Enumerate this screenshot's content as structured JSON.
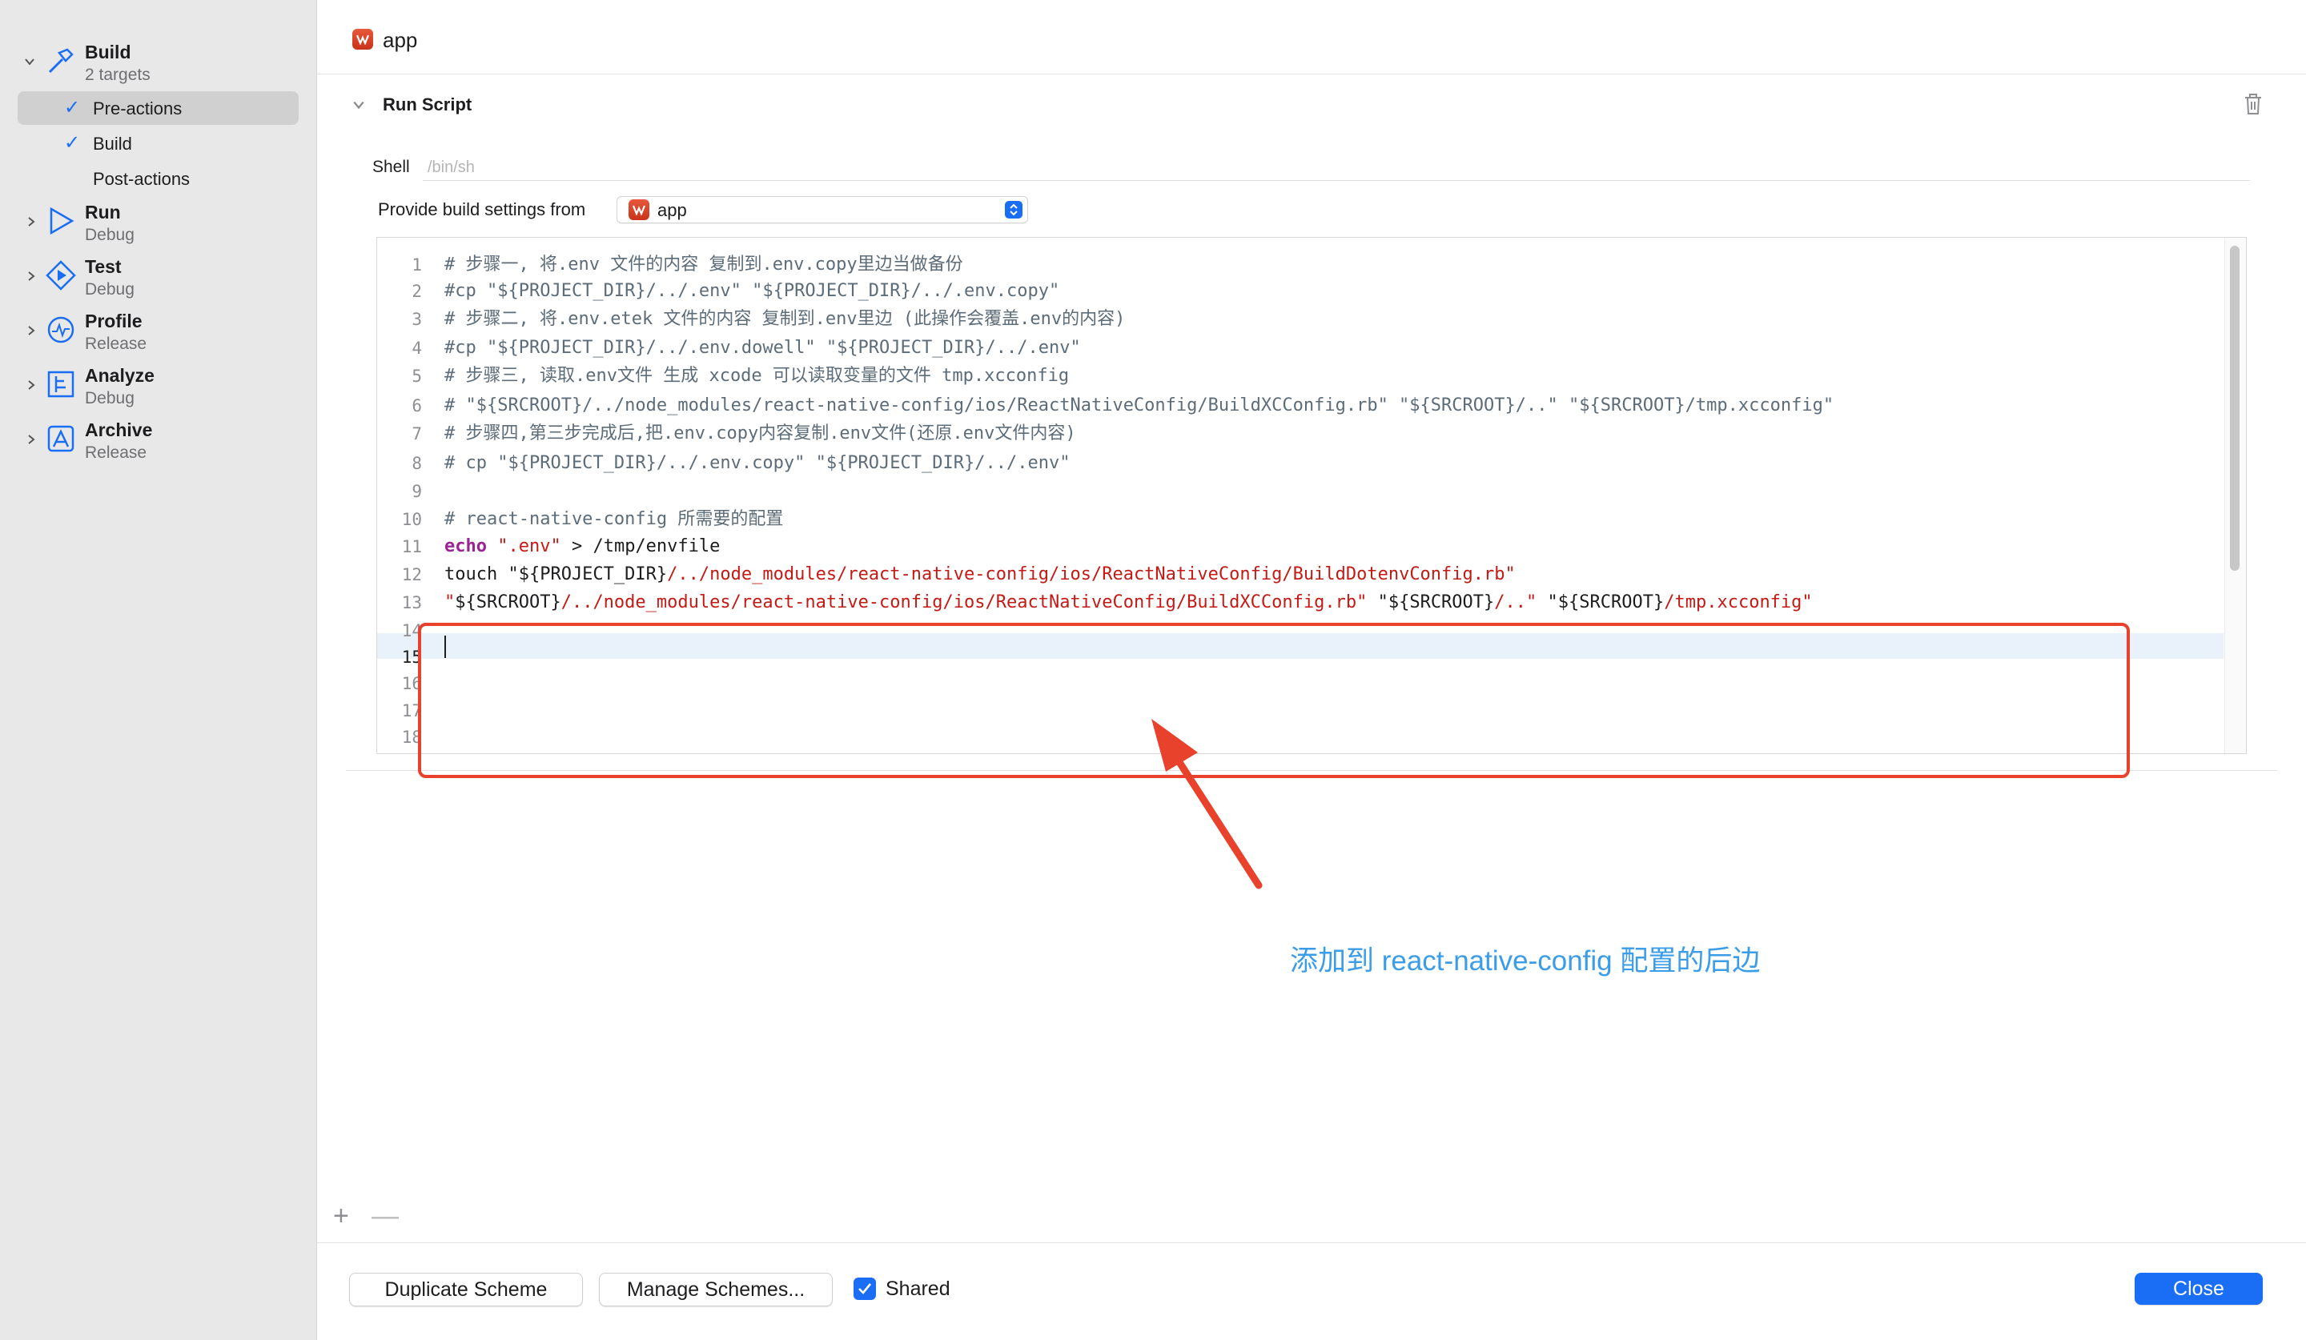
{
  "sidebar": {
    "actions": [
      {
        "title": "Build",
        "subtitle": "2 targets",
        "icon": "hammer-icon",
        "expanded": true
      },
      {
        "title": "Run",
        "subtitle": "Debug",
        "icon": "play-icon",
        "expanded": false
      },
      {
        "title": "Test",
        "subtitle": "Debug",
        "icon": "test-diamond-icon",
        "expanded": false
      },
      {
        "title": "Profile",
        "subtitle": "Release",
        "icon": "gauge-icon",
        "expanded": false
      },
      {
        "title": "Analyze",
        "subtitle": "Debug",
        "icon": "analyze-icon",
        "expanded": false
      },
      {
        "title": "Archive",
        "subtitle": "Release",
        "icon": "archive-icon",
        "expanded": false
      }
    ],
    "build_children": [
      {
        "label": "Pre-actions",
        "checked": true,
        "selected": true
      },
      {
        "label": "Build",
        "checked": true,
        "selected": false
      },
      {
        "label": "Post-actions",
        "checked": false,
        "selected": false
      }
    ]
  },
  "header": {
    "target_name": "app"
  },
  "run_script": {
    "title": "Run Script",
    "shell_label": "Shell",
    "shell_placeholder": "/bin/sh",
    "provide_label": "Provide build settings from",
    "provide_value": "app"
  },
  "editor": {
    "lines": [
      {
        "n": "1",
        "tokens": [
          {
            "t": "# 步骤一, 将.env 文件的内容 复制到.env.copy里边当做备份",
            "c": "comment"
          }
        ]
      },
      {
        "n": "2",
        "tokens": [
          {
            "t": "#cp \"${PROJECT_DIR}/../.env\" \"${PROJECT_DIR}/../.env.copy\"",
            "c": "comment"
          }
        ]
      },
      {
        "n": "3",
        "tokens": [
          {
            "t": "# 步骤二, 将.env.etek 文件的内容 复制到.env里边 (此操作会覆盖.env的内容)",
            "c": "comment"
          }
        ]
      },
      {
        "n": "4",
        "tokens": [
          {
            "t": "#cp \"${PROJECT_DIR}/../.env.dowell\" \"${PROJECT_DIR}/../.env\"",
            "c": "comment"
          }
        ]
      },
      {
        "n": "5",
        "tokens": [
          {
            "t": "# 步骤三, 读取.env文件 生成 xcode 可以读取变量的文件 tmp.xcconfig",
            "c": "comment"
          }
        ]
      },
      {
        "n": "6",
        "tokens": [
          {
            "t": "# \"${SRCROOT}/../node_modules/react-native-config/ios/ReactNativeConfig/BuildXCConfig.rb\" \"${SRCROOT}/..\" \"${SRCROOT}/tmp.xcconfig\"",
            "c": "comment"
          }
        ]
      },
      {
        "n": "7",
        "tokens": [
          {
            "t": "# 步骤四,第三步完成后,把.env.copy内容复制.env文件(还原.env文件内容)",
            "c": "comment"
          }
        ]
      },
      {
        "n": "8",
        "tokens": [
          {
            "t": "# cp \"${PROJECT_DIR}/../.env.copy\" \"${PROJECT_DIR}/../.env\"",
            "c": "comment"
          }
        ]
      },
      {
        "n": "9",
        "tokens": []
      },
      {
        "n": "10",
        "tokens": [
          {
            "t": "# react-native-config 所需要的配置",
            "c": "comment"
          }
        ]
      },
      {
        "n": "11",
        "tokens": [
          {
            "t": "echo",
            "c": "kw"
          },
          {
            "t": " ",
            "c": "plain"
          },
          {
            "t": "\".env\"",
            "c": "str"
          },
          {
            "t": " > /tmp/envfile",
            "c": "plain"
          }
        ]
      },
      {
        "n": "12",
        "tokens": [
          {
            "t": "touch \"${PROJECT_DIR}",
            "c": "plain"
          },
          {
            "t": "/../node_modules/react-native-config/ios/ReactNativeConfig/BuildDotenvConfig.rb\"",
            "c": "str"
          }
        ]
      },
      {
        "n": "13",
        "tokens": [
          {
            "t": "\"",
            "c": "str"
          },
          {
            "t": "${SRCROOT}",
            "c": "plain"
          },
          {
            "t": "/../node_modules/react-native-config/ios/ReactNativeConfig/BuildXCConfig.rb\"",
            "c": "str"
          },
          {
            "t": " \"${SRCROOT}",
            "c": "plain"
          },
          {
            "t": "/..\"",
            "c": "str"
          },
          {
            "t": " \"${SRCROOT}",
            "c": "plain"
          },
          {
            "t": "/tmp.xcconfig\"",
            "c": "str"
          }
        ]
      },
      {
        "n": "14",
        "tokens": []
      },
      {
        "n": "15",
        "tokens": [],
        "current": true
      },
      {
        "n": "16",
        "tokens": []
      },
      {
        "n": "17",
        "tokens": []
      },
      {
        "n": "18",
        "tokens": []
      }
    ]
  },
  "annotation": {
    "text": "添加到 react-native-config 配置的后边",
    "color": "#3b9ce8",
    "box_color": "#e8412c"
  },
  "list_controls": {
    "add": "+",
    "remove": "—"
  },
  "footer": {
    "duplicate_label": "Duplicate Scheme",
    "manage_label": "Manage Schemes...",
    "shared_label": "Shared",
    "shared_checked": true,
    "close_label": "Close"
  },
  "colors": {
    "accent": "#1a6ef5",
    "sidebar_bg": "#e8e8e8",
    "comment": "#5d6c79",
    "keyword": "#9b2393",
    "string": "#c41a16"
  }
}
